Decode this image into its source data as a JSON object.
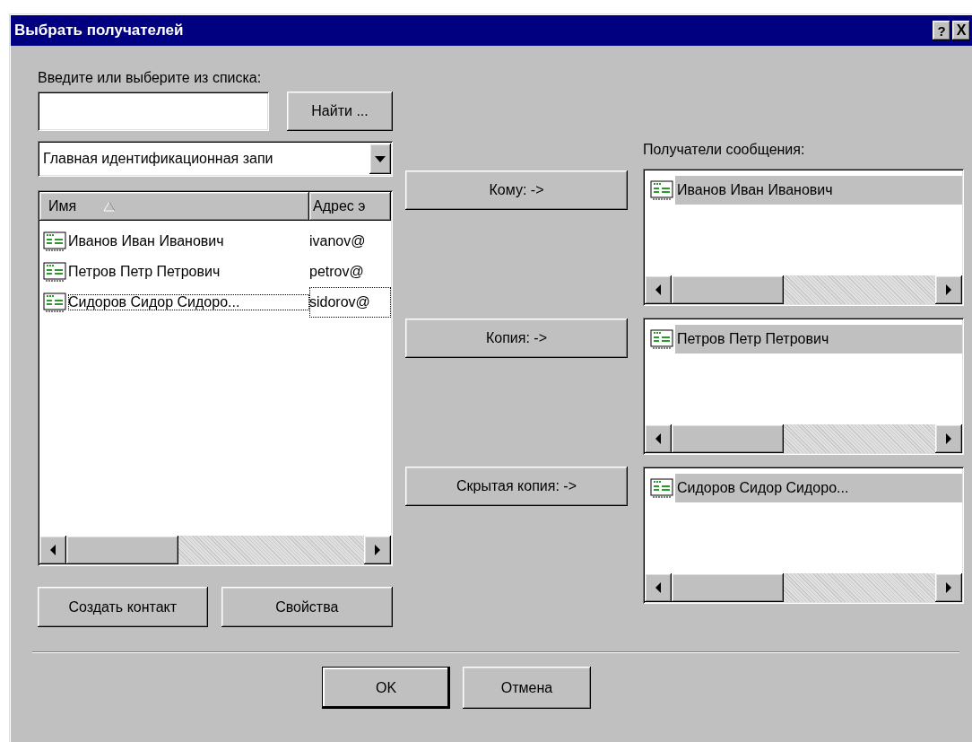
{
  "window": {
    "title": "Выбрать получателей",
    "title_buttons": [
      {
        "kind": "help",
        "label": "?"
      },
      {
        "kind": "close",
        "label": "X"
      }
    ]
  },
  "search": {
    "label": "Введите или выберите из списка:",
    "find_button": "Найти ..."
  },
  "address_book": {
    "value": "Главная идентификационная запи"
  },
  "contacts": {
    "columns": [
      {
        "label": "Имя",
        "sorted": true
      },
      {
        "label": "Адрес э",
        "sorted": false
      }
    ],
    "rows": [
      {
        "name": "Иванов Иван Иванович",
        "address": "ivanov@",
        "focused": false
      },
      {
        "name": "Петров Петр Петрович",
        "address": "petrov@",
        "focused": false
      },
      {
        "name": "Сидоров Сидор Сидоро...",
        "address": "sidorov@",
        "focused": true
      }
    ]
  },
  "contact_buttons": [
    "Создать контакт",
    "Свойства"
  ],
  "recipients": {
    "label": "Получатели сообщения:",
    "groups": [
      {
        "button": "Кому: ->",
        "items": [
          {
            "name": "Иванов Иван Иванович",
            "selected": true
          }
        ]
      },
      {
        "button": "Копия: ->",
        "items": [
          {
            "name": "Петров Петр Петрович",
            "selected": true
          }
        ]
      },
      {
        "button": "Скрытая копия: ->",
        "items": [
          {
            "name": "Сидоров Сидор Сидоро...",
            "selected": true
          }
        ]
      }
    ]
  },
  "buttons": [
    "OK",
    "Отмена"
  ]
}
